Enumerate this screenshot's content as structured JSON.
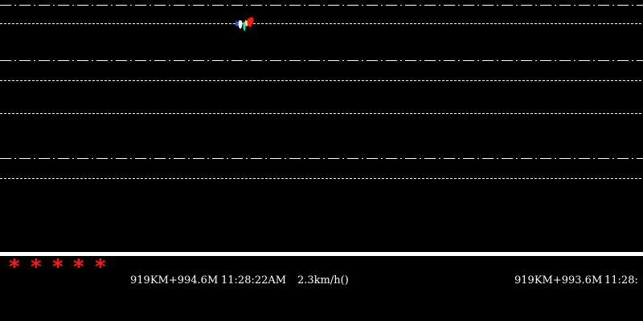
{
  "colors": {
    "background": "#000000",
    "track_lines": "#ffffff",
    "divider": "#ffffff",
    "text": "#ffffff",
    "alarm": "#ff1a1a"
  },
  "marker": {
    "name": "train-position-marker",
    "colors": [
      "#2b4cff",
      "#ffffff",
      "#26d9c8",
      "#ffd94a",
      "#ff1a1a"
    ]
  },
  "status": {
    "alarm_symbols": [
      "*",
      "*",
      "*",
      "*",
      "*"
    ],
    "readout_1": {
      "position": "919KM+994.6M",
      "time": "11:28:22AM",
      "speed": "2.3km/h()"
    },
    "readout_2": {
      "position": "919KM+993.6M",
      "time": "11:28:"
    }
  }
}
